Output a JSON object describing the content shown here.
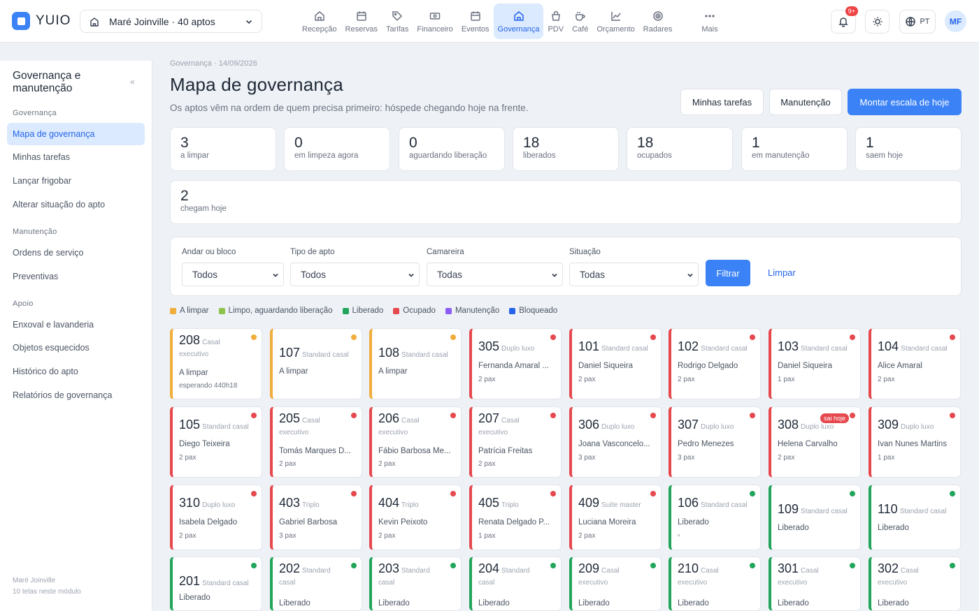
{
  "app": {
    "brand": "YUIO",
    "hotel": "Maré Joinville · 40 aptos"
  },
  "nav": [
    {
      "label": "Recepção",
      "icon": "home"
    },
    {
      "label": "Reservas",
      "icon": "calendar"
    },
    {
      "label": "Tarifas",
      "icon": "tag"
    },
    {
      "label": "Financeiro",
      "icon": "cash"
    },
    {
      "label": "Eventos",
      "icon": "calendar"
    },
    {
      "label": "Governança",
      "icon": "home",
      "active": true
    },
    {
      "label": "PDV",
      "icon": "bag"
    },
    {
      "label": "Café",
      "icon": "coffee"
    },
    {
      "label": "Orçamento",
      "icon": "chart"
    },
    {
      "label": "Radares",
      "icon": "target"
    },
    {
      "label": "Mais",
      "icon": "dots"
    }
  ],
  "topbar": {
    "notif_count": "9+",
    "lang": "PT",
    "avatar": "MF"
  },
  "sidebar": {
    "title": "Governança e manutenção",
    "collapse": "«",
    "sections": [
      {
        "label": "Governança",
        "items": [
          "Mapa de governança",
          "Minhas tarefas",
          "Lançar frigobar",
          "Alterar situação do apto"
        ]
      },
      {
        "label": "Manutenção",
        "items": [
          "Ordens de serviço",
          "Preventivas"
        ]
      },
      {
        "label": "Apoio",
        "items": [
          "Enxoval e lavanderia",
          "Objetos esquecidos",
          "Histórico do apto",
          "Relatórios de governança"
        ]
      }
    ],
    "footer": [
      "Maré Joinville",
      "10 telas neste módulo"
    ]
  },
  "page": {
    "breadcrumb": "Governança · 14/09/2026",
    "title": "Mapa de governança",
    "subtitle": "Os aptos vêm na ordem de quem precisa primeiro: hóspede chegando hoje na frente.",
    "buttons": {
      "tasks": "Minhas tarefas",
      "maintenance": "Manutenção",
      "schedule": "Montar escala de hoje"
    }
  },
  "stats": [
    {
      "num": "3",
      "label": "a limpar"
    },
    {
      "num": "0",
      "label": "em limpeza agora"
    },
    {
      "num": "0",
      "label": "aguardando liberação"
    },
    {
      "num": "18",
      "label": "liberados"
    },
    {
      "num": "18",
      "label": "ocupados"
    },
    {
      "num": "1",
      "label": "em manutenção"
    },
    {
      "num": "1",
      "label": "saem hoje"
    },
    {
      "num": "2",
      "label": "chegam hoje"
    }
  ],
  "filters": {
    "fields": [
      {
        "label": "Andar ou bloco",
        "value": "Todos"
      },
      {
        "label": "Tipo de apto",
        "value": "Todos"
      },
      {
        "label": "Camareira",
        "value": "Todas"
      },
      {
        "label": "Situação",
        "value": "Todas"
      }
    ],
    "submit": "Filtrar",
    "clear": "Limpar"
  },
  "legend": [
    {
      "label": "A limpar",
      "color": "#f0ad3c"
    },
    {
      "label": "Limpo, aguardando liberação",
      "color": "#8bc34a"
    },
    {
      "label": "Liberado",
      "color": "#22a55a"
    },
    {
      "label": "Ocupado",
      "color": "#e5484d"
    },
    {
      "label": "Manutenção",
      "color": "#8b5cf6"
    },
    {
      "label": "Bloqueado",
      "color": "#2563eb"
    }
  ],
  "colors": {
    "alimpar": "#f0ad3c",
    "liberado": "#22a55a",
    "ocupado": "#e5484d",
    "accent": "#3b82f6"
  },
  "rooms": [
    {
      "num": "208",
      "type": "Casal",
      "type2": "executivo",
      "l1": "A limpar",
      "l2": "esperando 440h18",
      "status": "alimpar"
    },
    {
      "num": "107",
      "type": "Standard casal",
      "l1": "A limpar",
      "status": "alimpar"
    },
    {
      "num": "108",
      "type": "Standard casal",
      "l1": "A limpar",
      "status": "alimpar"
    },
    {
      "num": "305",
      "type": "Duplo luxo",
      "l1": "Fernanda Amaral ...",
      "l2": "2 pax",
      "status": "ocupado"
    },
    {
      "num": "101",
      "type": "Standard casal",
      "l1": "Daniel Siqueira",
      "l2": "2 pax",
      "status": "ocupado"
    },
    {
      "num": "102",
      "type": "Standard casal",
      "l1": "Rodrigo Delgado",
      "l2": "2 pax",
      "status": "ocupado"
    },
    {
      "num": "103",
      "type": "Standard casal",
      "l1": "Daniel Siqueira",
      "l2": "1 pax",
      "status": "ocupado"
    },
    {
      "num": "104",
      "type": "Standard casal",
      "l1": "Alice Amaral",
      "l2": "2 pax",
      "status": "ocupado"
    },
    {
      "num": "105",
      "type": "Standard casal",
      "l1": "Diego Teixeira",
      "l2": "2 pax",
      "status": "ocupado"
    },
    {
      "num": "205",
      "type": "Casal",
      "type2": "executivo",
      "l1": "Tomás Marques D...",
      "l2": "2 pax",
      "status": "ocupado"
    },
    {
      "num": "206",
      "type": "Casal",
      "type2": "executivo",
      "l1": "Fábio Barbosa Me...",
      "l2": "2 pax",
      "status": "ocupado"
    },
    {
      "num": "207",
      "type": "Casal",
      "type2": "executivo",
      "l1": "Patrícia Freitas",
      "l2": "2 pax",
      "status": "ocupado"
    },
    {
      "num": "306",
      "type": "Duplo luxo",
      "l1": "Joana Vasconcelo...",
      "l2": "3 pax",
      "status": "ocupado"
    },
    {
      "num": "307",
      "type": "Duplo luxo",
      "l1": "Pedro Menezes",
      "l2": "3 pax",
      "status": "ocupado"
    },
    {
      "num": "308",
      "type": "Duplo luxo",
      "l1": "Helena Carvalho",
      "l2": "2 pax",
      "status": "ocupado",
      "badge": "sai hoje"
    },
    {
      "num": "309",
      "type": "Duplo luxo",
      "l1": "Ivan Nunes Martins",
      "l2": "1 pax",
      "status": "ocupado"
    },
    {
      "num": "310",
      "type": "Duplo luxo",
      "l1": "Isabela Delgado",
      "l2": "2 pax",
      "status": "ocupado"
    },
    {
      "num": "403",
      "type": "Triplo",
      "l1": "Gabriel Barbosa",
      "l2": "3 pax",
      "status": "ocupado"
    },
    {
      "num": "404",
      "type": "Triplo",
      "l1": "Kevin Peixoto",
      "l2": "2 pax",
      "status": "ocupado"
    },
    {
      "num": "405",
      "type": "Triplo",
      "l1": "Renata Delgado P...",
      "l2": "1 pax",
      "status": "ocupado"
    },
    {
      "num": "409",
      "type": "Suíte master",
      "l1": "Luciana Moreira",
      "l2": "2 pax",
      "status": "ocupado"
    },
    {
      "num": "106",
      "type": "Standard casal",
      "l1": "Liberado",
      "l2": "▫",
      "status": "liberado"
    },
    {
      "num": "109",
      "type": "Standard casal",
      "l1": "Liberado",
      "status": "liberado"
    },
    {
      "num": "110",
      "type": "Standard casal",
      "l1": "Liberado",
      "status": "liberado"
    },
    {
      "num": "201",
      "type": "Standard casal",
      "l1": "Liberado",
      "status": "liberado"
    },
    {
      "num": "202",
      "type": "Standard",
      "type2": "casal",
      "l1": "Liberado",
      "status": "liberado"
    },
    {
      "num": "203",
      "type": "Standard",
      "type2": "casal",
      "l1": "Liberado",
      "status": "liberado"
    },
    {
      "num": "204",
      "type": "Standard",
      "type2": "casal",
      "l1": "Liberado",
      "status": "liberado"
    },
    {
      "num": "209",
      "type": "Casal",
      "type2": "executivo",
      "l1": "Liberado",
      "status": "liberado"
    },
    {
      "num": "210",
      "type": "Casal",
      "type2": "executivo",
      "l1": "Liberado",
      "status": "liberado"
    },
    {
      "num": "301",
      "type": "Casal",
      "type2": "executivo",
      "l1": "Liberado",
      "status": "liberado"
    },
    {
      "num": "302",
      "type": "Casal",
      "type2": "executivo",
      "l1": "Liberado",
      "status": "liberado"
    }
  ]
}
